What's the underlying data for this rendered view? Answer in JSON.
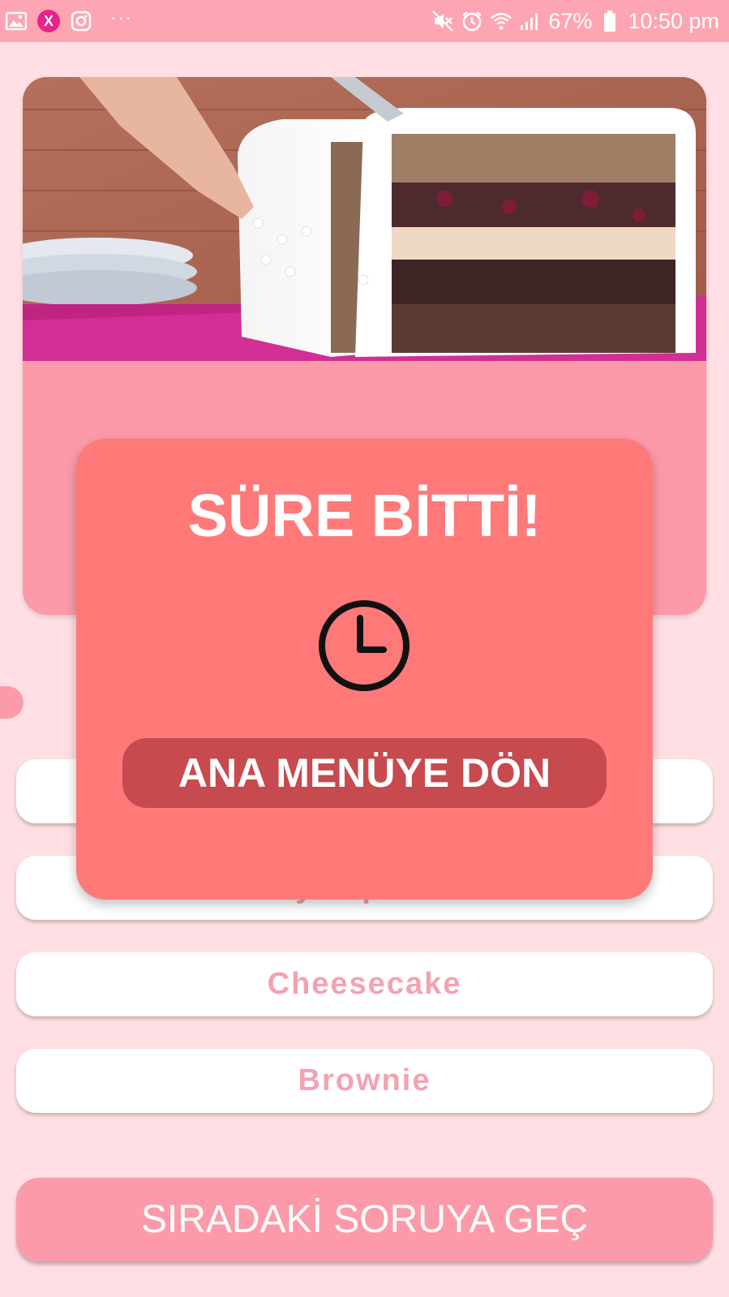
{
  "status_bar": {
    "battery": "67%",
    "time": "10:50 pm",
    "icons": [
      "gallery-icon",
      "x-app-icon",
      "instagram-icon",
      "more-icon",
      "mute-icon",
      "alarm-icon",
      "wifi-icon",
      "signal-icon",
      "battery-icon"
    ]
  },
  "question": {
    "image": "cake-slice-photo",
    "text": ""
  },
  "options": [
    {
      "label": ""
    },
    {
      "label": "Meyve pastası"
    },
    {
      "label": "Cheesecake"
    },
    {
      "label": "Brownie"
    }
  ],
  "next_button": {
    "label": "SIRADAKİ SORUYA GEÇ"
  },
  "dialog": {
    "title": "SÜRE BİTTİ!",
    "icon": "clock-icon",
    "button_label": "ANA MENÜYE DÖN"
  },
  "colors": {
    "status_bar": "#fea5b3",
    "background": "#ffdfe3",
    "question_card": "#fc9aaa",
    "option_text": "#f3a3b0",
    "dialog": "#ff7979",
    "dialog_button": "#c64a4e"
  }
}
